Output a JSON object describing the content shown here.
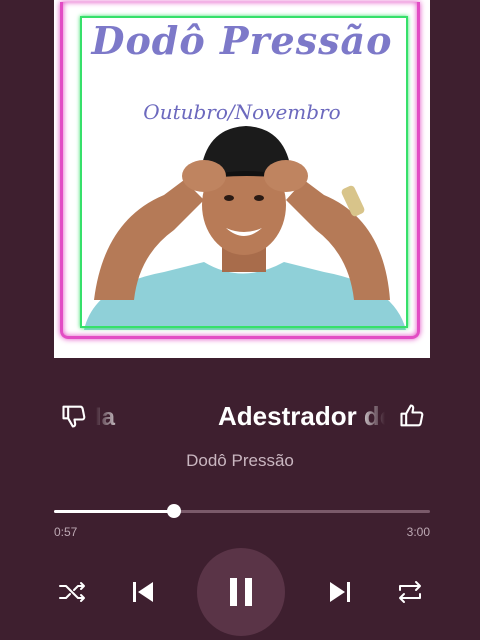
{
  "album_art": {
    "title": "Dodô Pressão",
    "subtitle": "Outubro/Novembro"
  },
  "track": {
    "title_previous_fragment": "la",
    "title": "Adestrador de",
    "artist": "Dodô Pressão"
  },
  "progress": {
    "current_time": "0:57",
    "total_time": "3:00",
    "fraction": 0.32
  },
  "icons": {
    "dislike": "thumbs-down-icon",
    "like": "thumbs-up-icon",
    "shuffle": "shuffle-icon",
    "previous": "skip-previous-icon",
    "pause": "pause-icon",
    "next": "skip-next-icon",
    "repeat": "repeat-icon"
  },
  "colors": {
    "background": "#3e1f2f",
    "play_button": "#5a3447",
    "art_title": "#7d79c9",
    "frame_pink": "#e24cc4",
    "frame_green": "#36e06a"
  }
}
